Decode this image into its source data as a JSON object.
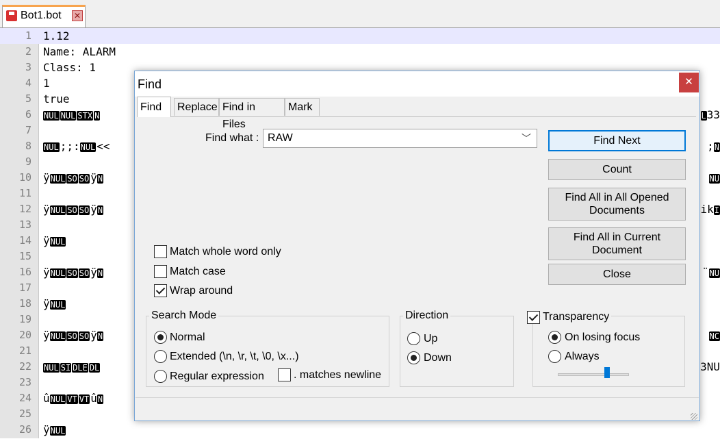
{
  "editor": {
    "tab_name": "Bot1.bot",
    "lines": [
      {
        "n": "1",
        "segs": [
          {
            "t": "1.12"
          }
        ]
      },
      {
        "n": "2",
        "segs": [
          {
            "t": "Name: ALARM"
          }
        ]
      },
      {
        "n": "3",
        "segs": [
          {
            "t": "Class: 1"
          }
        ]
      },
      {
        "n": "4",
        "segs": [
          {
            "t": "1"
          }
        ]
      },
      {
        "n": "5",
        "segs": [
          {
            "t": "true"
          }
        ]
      },
      {
        "n": "6",
        "segs": [
          {
            "c": "NUL"
          },
          {
            "c": "NUL"
          },
          {
            "c": "STX"
          },
          {
            "c": "N"
          }
        ]
      },
      {
        "n": "7",
        "segs": []
      },
      {
        "n": "8",
        "segs": [
          {
            "c": "NUL"
          },
          {
            "t": ";;:"
          },
          {
            "c": "NUL"
          },
          {
            "t": "<<"
          }
        ]
      },
      {
        "n": "9",
        "segs": []
      },
      {
        "n": "10",
        "segs": [
          {
            "t": "ÿ"
          },
          {
            "c": "NUL"
          },
          {
            "c": "SO"
          },
          {
            "c": "SO"
          },
          {
            "t": "ÿ"
          },
          {
            "c": "N"
          }
        ]
      },
      {
        "n": "11",
        "segs": []
      },
      {
        "n": "12",
        "segs": [
          {
            "t": "ÿ"
          },
          {
            "c": "NUL"
          },
          {
            "c": "SO"
          },
          {
            "c": "SO"
          },
          {
            "t": "ÿ"
          },
          {
            "c": "N"
          }
        ]
      },
      {
        "n": "13",
        "segs": []
      },
      {
        "n": "14",
        "segs": [
          {
            "t": "ÿ"
          },
          {
            "c": "NUL"
          }
        ]
      },
      {
        "n": "15",
        "segs": []
      },
      {
        "n": "16",
        "segs": [
          {
            "t": "ÿ"
          },
          {
            "c": "NUL"
          },
          {
            "c": "SO"
          },
          {
            "c": "SO"
          },
          {
            "t": "ÿ"
          },
          {
            "c": "N"
          }
        ]
      },
      {
        "n": "17",
        "segs": []
      },
      {
        "n": "18",
        "segs": [
          {
            "t": "ÿ"
          },
          {
            "c": "NUL"
          }
        ]
      },
      {
        "n": "19",
        "segs": []
      },
      {
        "n": "20",
        "segs": [
          {
            "t": "ÿ"
          },
          {
            "c": "NUL"
          },
          {
            "c": "SO"
          },
          {
            "c": "SO"
          },
          {
            "t": "ÿ"
          },
          {
            "c": "N"
          }
        ]
      },
      {
        "n": "21",
        "segs": []
      },
      {
        "n": "22",
        "segs": [
          {
            "c": "NUL"
          },
          {
            "c": "SI"
          },
          {
            "c": "DLE"
          },
          {
            "c": "DL"
          }
        ]
      },
      {
        "n": "23",
        "segs": []
      },
      {
        "n": "24",
        "segs": [
          {
            "t": "û"
          },
          {
            "c": "NUL"
          },
          {
            "c": "VT"
          },
          {
            "c": "VT"
          },
          {
            "t": "û"
          },
          {
            "c": "N"
          }
        ]
      },
      {
        "n": "25",
        "segs": []
      },
      {
        "n": "26",
        "segs": [
          {
            "t": "ÿ"
          },
          {
            "c": "NUL"
          }
        ]
      }
    ],
    "right_fragments": [
      {
        "line": 6,
        "segs": [
          {
            "c": "L"
          },
          {
            "t": "33"
          }
        ]
      },
      {
        "line": 8,
        "segs": [
          {
            "t": ";"
          },
          {
            "c": "N"
          }
        ]
      },
      {
        "line": 10,
        "segs": [
          {
            "c": "NU"
          }
        ]
      },
      {
        "line": 12,
        "segs": [
          {
            "t": "ik"
          },
          {
            "c": "I"
          }
        ]
      },
      {
        "line": 16,
        "segs": [
          {
            "t": "¨"
          },
          {
            "c": "NU"
          }
        ]
      },
      {
        "line": 20,
        "segs": [
          {
            "c": "NC"
          }
        ]
      },
      {
        "line": 22,
        "segs": [
          {
            "t": "3NU"
          }
        ]
      }
    ]
  },
  "dialog": {
    "title": "Find",
    "close_symbol": "✕",
    "tabs": [
      "Find",
      "Replace",
      "Find in Files",
      "Mark"
    ],
    "find_what_label": "Find what :",
    "find_what_value": "RAW",
    "buttons": {
      "find_next": "Find Next",
      "count": "Count",
      "find_all_opened_1": "Find All in All Opened",
      "find_all_opened_2": "Documents",
      "find_all_current_1": "Find All in Current",
      "find_all_current_2": "Document",
      "close": "Close"
    },
    "options": {
      "match_whole_word": "Match whole word only",
      "match_case": "Match case",
      "wrap_around": "Wrap around"
    },
    "search_mode": {
      "title": "Search Mode",
      "normal": "Normal",
      "extended": "Extended (\\n, \\r, \\t, \\0, \\x...)",
      "regex": "Regular expression",
      "dot_newline": ". matches newline"
    },
    "direction": {
      "title": "Direction",
      "up": "Up",
      "down": "Down"
    },
    "transparency": {
      "title": "Transparency",
      "on_losing_focus": "On losing focus",
      "always": "Always"
    }
  }
}
